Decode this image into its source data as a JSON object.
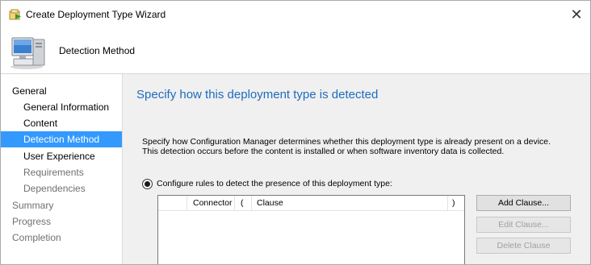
{
  "window": {
    "title": "Create Deployment Type Wizard",
    "close_glyph": "✕",
    "icons": {
      "app": "wizard-app-icon",
      "close": "close-icon"
    }
  },
  "header": {
    "title": "Detection Method",
    "icon": "computer-icon"
  },
  "nav": {
    "items": [
      {
        "label": "General",
        "state": "normal",
        "level": 0
      },
      {
        "label": "General Information",
        "state": "normal",
        "level": 1
      },
      {
        "label": "Content",
        "state": "normal",
        "level": 1
      },
      {
        "label": "Detection Method",
        "state": "selected",
        "level": 1
      },
      {
        "label": "User Experience",
        "state": "normal",
        "level": 1
      },
      {
        "label": "Requirements",
        "state": "disabled",
        "level": 1
      },
      {
        "label": "Dependencies",
        "state": "disabled",
        "level": 1
      },
      {
        "label": "Summary",
        "state": "disabled",
        "level": 0
      },
      {
        "label": "Progress",
        "state": "disabled",
        "level": 0
      },
      {
        "label": "Completion",
        "state": "disabled",
        "level": 0
      }
    ],
    "selected_color": "#3399ff"
  },
  "main": {
    "heading": "Specify how this deployment type is detected",
    "heading_color": "#1f6bbf",
    "description": "Specify how Configuration Manager determines whether this deployment type is already present on a device. This detection occurs before the content is installed or when software inventory data is collected.",
    "radio_label": "Configure rules to detect the presence of this deployment type:",
    "radio_checked": true,
    "table": {
      "columns": [
        "",
        "Connector",
        "(",
        "Clause",
        ")"
      ],
      "rows": []
    },
    "buttons": {
      "add_clause": "Add Clause...",
      "edit_clause": "Edit Clause...",
      "delete_clause": "Delete Clause"
    }
  }
}
